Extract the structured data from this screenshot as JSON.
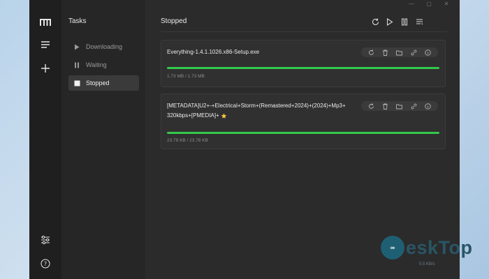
{
  "sidebar": {
    "title": "Tasks",
    "items": [
      {
        "label": "Downloading",
        "icon": "play-icon"
      },
      {
        "label": "Waiting",
        "icon": "pause-icon"
      },
      {
        "label": "Stopped",
        "icon": "stop-icon",
        "active": true
      }
    ]
  },
  "main": {
    "title": "Stopped",
    "header_icons": [
      "refresh-icon",
      "play-icon",
      "pause-icon",
      "list-icon"
    ]
  },
  "downloads": [
    {
      "name": "Everything-1.4.1.1026.x86-Setup.exe",
      "size": "1.73 MB / 1.73 MB",
      "progress": 1.0
    },
    {
      "name_line1": "[METADATA]U2+-+Electrical+Storm+(Remastered+2024)+(2024)+Mp3+",
      "name_line2": "320kbps+[PMEDIA]+",
      "size": "23.78 KB / 23.78 KB",
      "progress": 1.0
    }
  ],
  "watermark": {
    "logo_text": "∞",
    "text": "eskTop",
    "speed": "5.5 KB/s"
  },
  "colors": {
    "accent": "#33c94c",
    "background": "#2b2b2b",
    "rail": "#1f1f1f",
    "sidebar": "#262626"
  }
}
